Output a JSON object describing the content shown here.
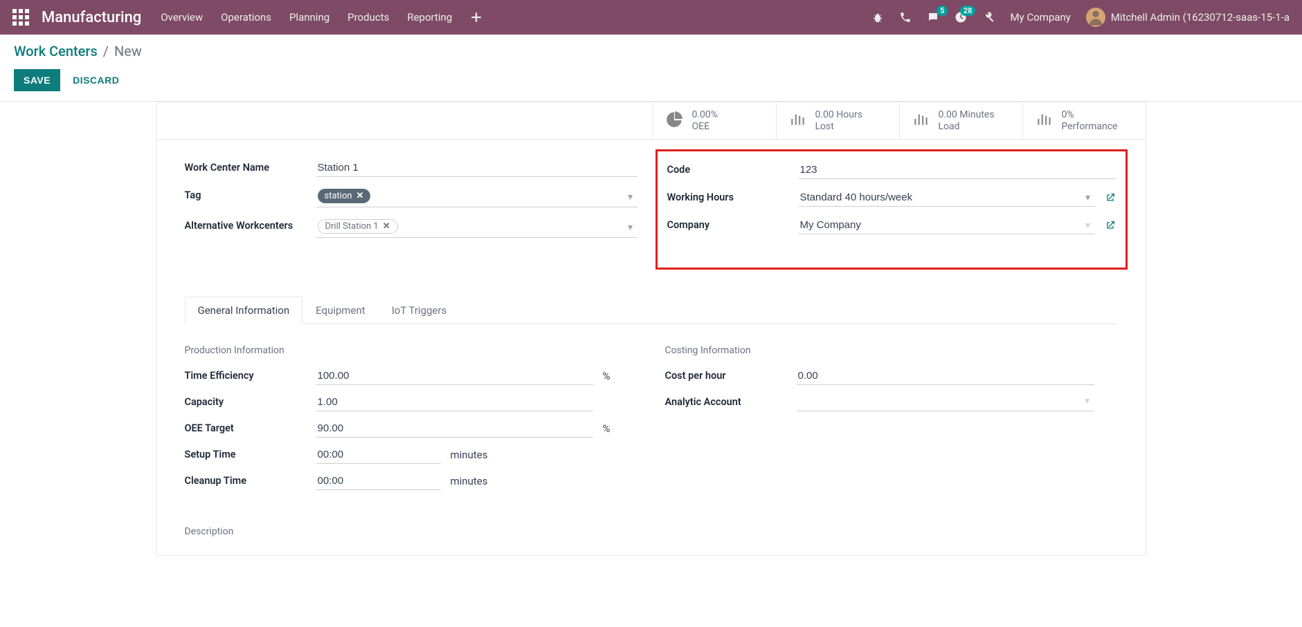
{
  "nav": {
    "brand": "Manufacturing",
    "items": [
      "Overview",
      "Operations",
      "Planning",
      "Products",
      "Reporting"
    ],
    "chat_badge": "5",
    "activity_badge": "28",
    "company": "My Company",
    "user": "Mitchell Admin (16230712-saas-15-1-a"
  },
  "control": {
    "crumb_root": "Work Centers",
    "crumb_sep": "/",
    "crumb_new": "New",
    "save": "SAVE",
    "discard": "DISCARD"
  },
  "stats": {
    "oee_val": "0.00%",
    "oee_lbl": "OEE",
    "lost_val": "0.00 Hours",
    "lost_lbl": "Lost",
    "load_val": "0.00 Minutes",
    "load_lbl": "Load",
    "perf_val": "0%",
    "perf_lbl": "Performance"
  },
  "form": {
    "name_label": "Work Center Name",
    "name_value": "Station 1",
    "tag_label": "Tag",
    "tag_value": "station",
    "alt_label": "Alternative Workcenters",
    "alt_value": "Drill Station 1",
    "code_label": "Code",
    "code_value": "123",
    "wh_label": "Working Hours",
    "wh_value": "Standard 40 hours/week",
    "company_label": "Company",
    "company_value": "My Company"
  },
  "tabs": {
    "general": "General Information",
    "equipment": "Equipment",
    "iot": "IoT Triggers"
  },
  "general": {
    "prod_section": "Production Information",
    "te_label": "Time Efficiency",
    "te_value": "100.00",
    "te_unit": "%",
    "cap_label": "Capacity",
    "cap_value": "1.00",
    "oee_label": "OEE Target",
    "oee_value": "90.00",
    "oee_unit": "%",
    "setup_label": "Setup Time",
    "setup_value": "00:00",
    "setup_unit": "minutes",
    "cleanup_label": "Cleanup Time",
    "cleanup_value": "00:00",
    "cleanup_unit": "minutes",
    "cost_section": "Costing Information",
    "cph_label": "Cost per hour",
    "cph_value": "0.00",
    "aa_label": "Analytic Account",
    "desc_label": "Description"
  }
}
